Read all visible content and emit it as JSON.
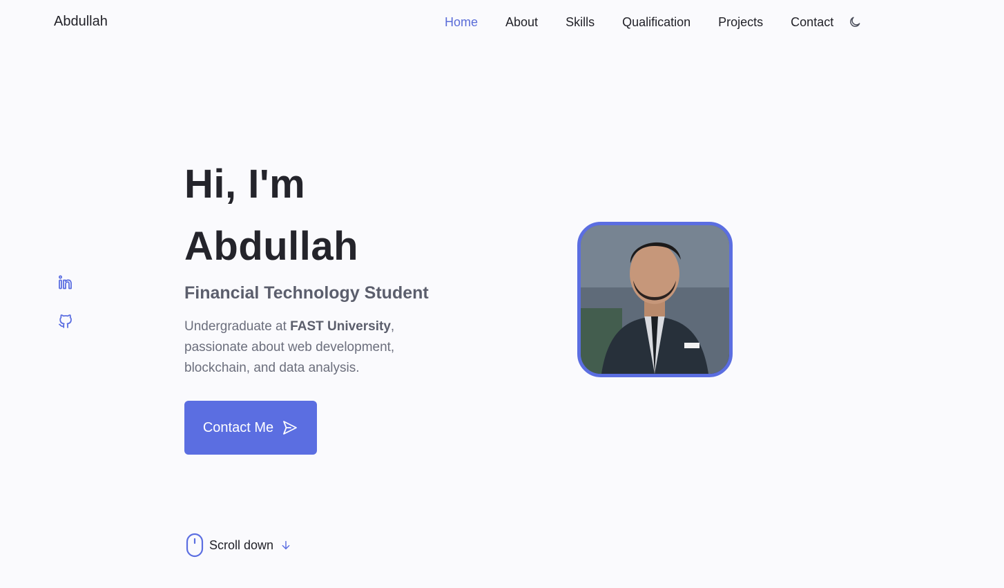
{
  "header": {
    "logo": "Abdullah",
    "nav": {
      "home": "Home",
      "about": "About",
      "skills": "Skills",
      "qualification": "Qualification",
      "projects": "Projects",
      "contact": "Contact"
    },
    "theme_icon": "moon-icon"
  },
  "socials": [
    "linkedin-icon",
    "github-icon"
  ],
  "hero": {
    "title_line1": "Hi, I'm",
    "title_line2": "Abdullah",
    "subtitle": "Financial Technology Student",
    "desc_prefix": "Undergraduate at ",
    "desc_bold": "FAST University",
    "desc_suffix": ", passionate about web development, blockchain, and data analysis.",
    "button_label": "Contact Me",
    "button_icon": "send-icon"
  },
  "scroll": {
    "label": "Scroll down",
    "icons": [
      "mouse-icon",
      "arrow-down-icon"
    ]
  },
  "colors": {
    "accent": "#5b6ee1",
    "background": "#fafafd",
    "title": "#24242b",
    "text": "#6b6e7c"
  }
}
